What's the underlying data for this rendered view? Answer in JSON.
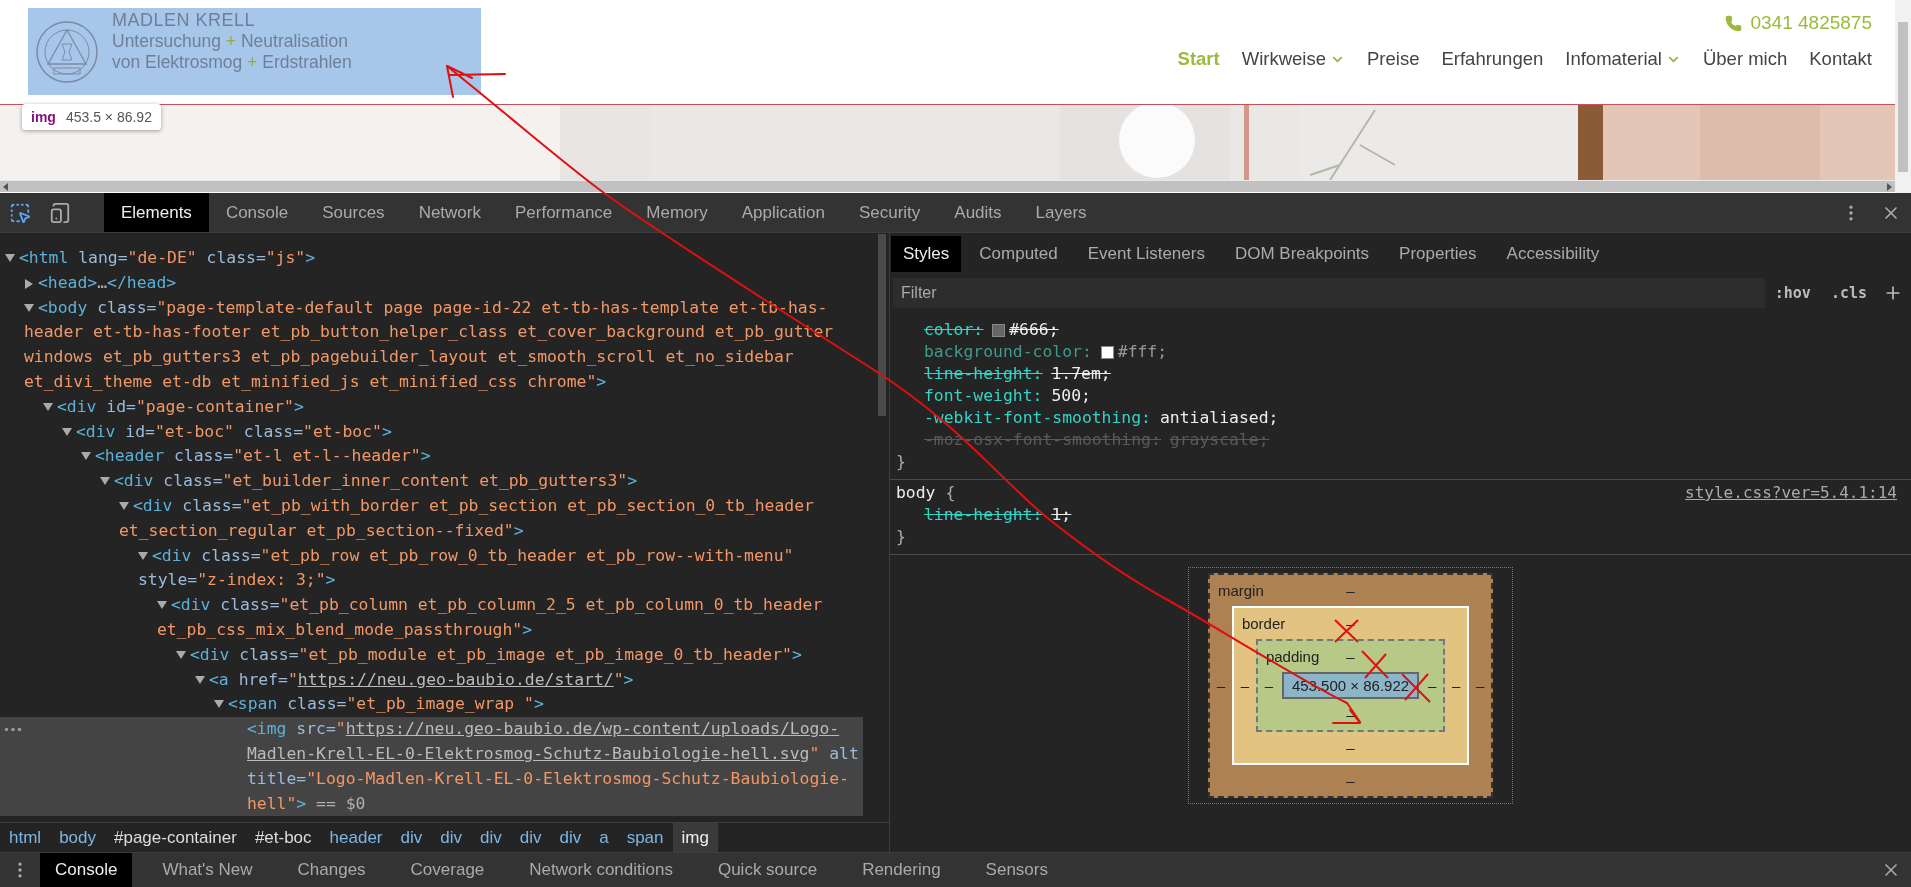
{
  "website": {
    "logo": {
      "lines": [
        "MADLEN KRELL",
        "Untersuchung + Neutralisation",
        "von Elektrosmog + Erdstrahlen"
      ]
    },
    "inspect_tooltip": {
      "tag": "img",
      "size": "453.5 × 86.92"
    },
    "phone": "0341 4825875",
    "nav": [
      {
        "label": "Start",
        "selected": true,
        "has_submenu": false
      },
      {
        "label": "Wirkweise",
        "selected": false,
        "has_submenu": true
      },
      {
        "label": "Preise",
        "selected": false,
        "has_submenu": false
      },
      {
        "label": "Erfahrungen",
        "selected": false,
        "has_submenu": false
      },
      {
        "label": "Infomaterial",
        "selected": false,
        "has_submenu": true
      },
      {
        "label": "Über mich",
        "selected": false,
        "has_submenu": false
      },
      {
        "label": "Kontakt",
        "selected": false,
        "has_submenu": false
      }
    ]
  },
  "devtools": {
    "main_tabs": [
      {
        "label": "Elements",
        "selected": true
      },
      {
        "label": "Console",
        "selected": false
      },
      {
        "label": "Sources",
        "selected": false
      },
      {
        "label": "Network",
        "selected": false
      },
      {
        "label": "Performance",
        "selected": false
      },
      {
        "label": "Memory",
        "selected": false
      },
      {
        "label": "Application",
        "selected": false
      },
      {
        "label": "Security",
        "selected": false
      },
      {
        "label": "Audits",
        "selected": false
      },
      {
        "label": "Layers",
        "selected": false
      }
    ],
    "dom_tree": [
      {
        "text": "<html lang=\"de-DE\" class=\"js\">",
        "expanded": true,
        "selected": false,
        "children": [
          {
            "text": "<head>…</head>",
            "expanded": false,
            "selected": false
          },
          {
            "text": "<body class=\"page-template-default page page-id-22 et-tb-has-template et-tb-has-header et-tb-has-footer et_pb_button_helper_class et_cover_background et_pb_gutter windows et_pb_gutters3 et_pb_pagebuilder_layout et_smooth_scroll et_no_sidebar et_divi_theme et-db et_minified_js et_minified_css chrome\">",
            "expanded": true,
            "selected": false,
            "children": [
              {
                "text": "<div id=\"page-container\">",
                "expanded": true,
                "selected": false,
                "children": [
                  {
                    "text": "<div id=\"et-boc\" class=\"et-boc\">",
                    "expanded": true,
                    "selected": false,
                    "children": [
                      {
                        "text": "<header class=\"et-l et-l--header\">",
                        "expanded": true,
                        "selected": false,
                        "children": [
                          {
                            "text": "<div class=\"et_builder_inner_content et_pb_gutters3\">",
                            "expanded": true,
                            "selected": false,
                            "children": [
                              {
                                "text": "<div class=\"et_pb_with_border et_pb_section et_pb_section_0_tb_header et_section_regular et_pb_section--fixed\">",
                                "expanded": true,
                                "selected": false,
                                "children": [
                                  {
                                    "text": "<div class=\"et_pb_row et_pb_row_0_tb_header et_pb_row--with-menu\" style=\"z-index: 3;\">",
                                    "expanded": true,
                                    "selected": false,
                                    "children": [
                                      {
                                        "text": "<div class=\"et_pb_column et_pb_column_2_5 et_pb_column_0_tb_header et_pb_css_mix_blend_mode_passthrough\">",
                                        "expanded": true,
                                        "selected": false,
                                        "children": [
                                          {
                                            "text": "<div class=\"et_pb_module et_pb_image et_pb_image_0_tb_header\">",
                                            "expanded": true,
                                            "selected": false,
                                            "children": [
                                              {
                                                "text": "<a href=\"https://neu.geo-baubio.de/start/\">",
                                                "expanded": true,
                                                "selected": false,
                                                "children": [
                                                  {
                                                    "text": "<span class=\"et_pb_image_wrap \">",
                                                    "expanded": true,
                                                    "selected": false,
                                                    "children": [
                                                      {
                                                        "text": "<img src=\"https://neu.geo-baubio.de/wp-content/uploads/Logo-Madlen-Krell-EL-0-Elektrosmog-Schutz-Baubiologie-hell.svg\" alt title=\"Logo-Madlen-Krell-EL-0-Elektrosmog-Schutz-Baubiologie-hell\"> == $0",
                                                        "selected": true
                                                      }
                                                    ]
                                                  }
                                                ]
                                              }
                                            ]
                                          }
                                        ]
                                      }
                                    ]
                                  }
                                ]
                              }
                            ]
                          }
                        ]
                      }
                    ]
                  }
                ]
              }
            ]
          }
        ]
      }
    ],
    "breadcrumbs": [
      {
        "label": "html",
        "kind": "tag",
        "selected": false
      },
      {
        "label": "body",
        "kind": "tag",
        "selected": false
      },
      {
        "label": "#page-container",
        "kind": "id",
        "selected": false
      },
      {
        "label": "#et-boc",
        "kind": "id",
        "selected": false
      },
      {
        "label": "header",
        "kind": "tag",
        "selected": false
      },
      {
        "label": "div",
        "kind": "tag",
        "selected": false
      },
      {
        "label": "div",
        "kind": "tag",
        "selected": false
      },
      {
        "label": "div",
        "kind": "tag",
        "selected": false
      },
      {
        "label": "div",
        "kind": "tag",
        "selected": false
      },
      {
        "label": "div",
        "kind": "tag",
        "selected": false
      },
      {
        "label": "a",
        "kind": "tag",
        "selected": false
      },
      {
        "label": "span",
        "kind": "tag",
        "selected": false
      },
      {
        "label": "img",
        "kind": "tag",
        "selected": true
      }
    ],
    "side_tabs": [
      {
        "label": "Styles",
        "selected": true
      },
      {
        "label": "Computed",
        "selected": false
      },
      {
        "label": "Event Listeners",
        "selected": false
      },
      {
        "label": "DOM Breakpoints",
        "selected": false
      },
      {
        "label": "Properties",
        "selected": false
      },
      {
        "label": "Accessibility",
        "selected": false
      }
    ],
    "filter": {
      "placeholder": "Filter",
      "buttons": [
        ":hov",
        ".cls"
      ]
    },
    "rules": [
      {
        "declarations": [
          {
            "property": "color:",
            "value": "#666;",
            "overridden": true,
            "inactive": false,
            "color": "#666666"
          },
          {
            "property": "background-color:",
            "value": "#fff;",
            "overridden": false,
            "inactive": true,
            "color": "#ffffff"
          },
          {
            "property": "line-height:",
            "value": "1.7em;",
            "overridden": true,
            "inactive": false
          },
          {
            "property": "font-weight:",
            "value": "500;",
            "overridden": false,
            "inactive": false
          },
          {
            "property": "-webkit-font-smoothing:",
            "value": "antialiased;",
            "overridden": false,
            "inactive": false
          },
          {
            "property": "-moz-osx-font-smoothing:",
            "value": "grayscale;",
            "overridden": true,
            "inactive": true
          }
        ],
        "close": "}"
      },
      {
        "selector": "body",
        "open": "{",
        "source": "style.css?ver=5.4.1:14",
        "declarations": [
          {
            "property": "line-height:",
            "value": "1;",
            "overridden": true,
            "inactive": false
          }
        ],
        "close": "}"
      }
    ],
    "box_model": {
      "margin": {
        "label": "margin",
        "top": "–",
        "right": "–",
        "bottom": "–",
        "left": "–"
      },
      "border": {
        "label": "border",
        "top": "–",
        "right": "–",
        "bottom": "–",
        "left": "–"
      },
      "padding": {
        "label": "padding",
        "top": "–",
        "right": "–",
        "bottom": "–",
        "left": "–"
      },
      "content": "453.500 × 86.922"
    },
    "drawer_tabs": [
      {
        "label": "Console",
        "selected": true
      },
      {
        "label": "What's New",
        "selected": false
      },
      {
        "label": "Changes",
        "selected": false
      },
      {
        "label": "Coverage",
        "selected": false
      },
      {
        "label": "Network conditions",
        "selected": false
      },
      {
        "label": "Quick source",
        "selected": false
      },
      {
        "label": "Rendering",
        "selected": false
      },
      {
        "label": "Sensors",
        "selected": false
      }
    ]
  }
}
